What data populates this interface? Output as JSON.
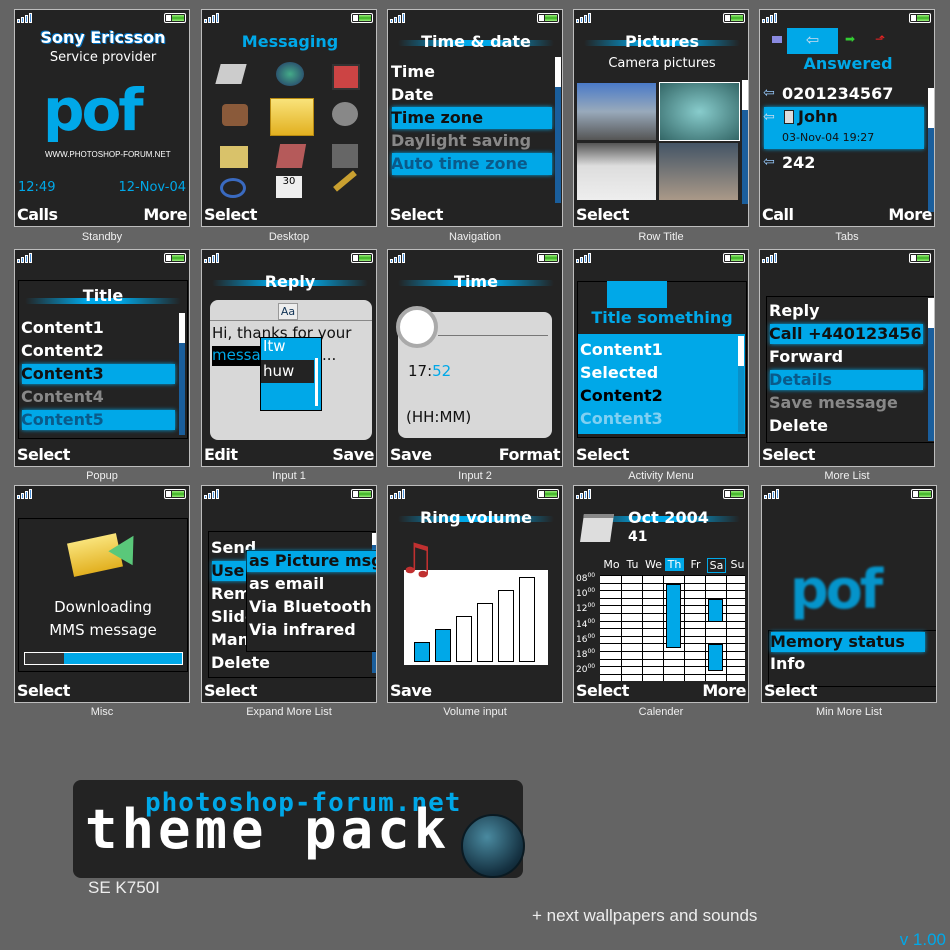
{
  "screens": {
    "standby": {
      "caption": "Standby",
      "operator": "Sony Ericsson",
      "provider": "Service provider",
      "logo": "pof",
      "logo_url": "WWW.PHOTOSHOP-FORUM.NET",
      "time": "12:49",
      "date": "12-Nov-04",
      "soft_left": "Calls",
      "soft_right": "More"
    },
    "desktop": {
      "caption": "Desktop",
      "title": "Messaging",
      "icons": [
        "call-list-icon",
        "internet-icon",
        "entertainment-icon",
        "camera-icon",
        "messaging-icon",
        "media-player-icon",
        "file-manager-icon",
        "phonebook-icon",
        "radio-icon",
        "connectivity-icon",
        "organizer-icon",
        "settings-icon"
      ],
      "soft_left": "Select"
    },
    "navigation": {
      "caption": "Navigation",
      "title": "Time & date",
      "items": [
        "Time",
        "Date",
        "Time zone",
        "Daylight saving",
        "Auto time zone"
      ],
      "soft_left": "Select"
    },
    "row_title": {
      "caption": "Row Title",
      "title": "Pictures",
      "subtitle": "Camera pictures",
      "soft_left": "Select"
    },
    "tabs": {
      "caption": "Tabs",
      "tab_label": "Answered",
      "entries": [
        {
          "name": "0201234567",
          "detail": ""
        },
        {
          "name": "John",
          "detail": "03-Nov-04 19:27"
        },
        {
          "name": "242",
          "detail": ""
        }
      ],
      "soft_left": "Call",
      "soft_right": "More"
    },
    "popup": {
      "caption": "Popup",
      "title": "Title",
      "items": [
        "Content1",
        "Content2",
        "Content3",
        "Content4",
        "Content5"
      ],
      "soft_left": "Select"
    },
    "input1": {
      "caption": "Input 1",
      "title": "Reply",
      "mode": "Aa",
      "text_line1": "Hi, thanks for your",
      "text_word": "messag",
      "text_rest": "...",
      "suggestions": [
        "Itw",
        "huw"
      ],
      "soft_left": "Edit",
      "soft_right": "Save"
    },
    "input2": {
      "caption": "Input 2",
      "title": "Time",
      "hours": "17:",
      "minutes": "52",
      "format": "(HH:MM)",
      "soft_left": "Save",
      "soft_right": "Format"
    },
    "activity": {
      "caption": "Activity Menu",
      "title": "Title something",
      "items": [
        "Content1",
        "Selected",
        "Content2",
        "Content3"
      ],
      "soft_left": "Select"
    },
    "more_list": {
      "caption": "More List",
      "items": [
        "Reply",
        "Call +440123456",
        "Forward",
        "Details",
        "Save message",
        "Delete"
      ],
      "soft_left": "Select"
    },
    "misc": {
      "caption": "Misc",
      "line1": "Downloading",
      "line2": "MMS message",
      "progress": 0.75,
      "soft_left": "Select"
    },
    "expand": {
      "caption": "Expand More List",
      "items": [
        "Send",
        "Use",
        "Rem",
        "Slide",
        "Many",
        "Delete"
      ],
      "submenu": [
        "as Picture msg",
        "as email",
        "Via Bluetooth",
        "Via infrared"
      ],
      "soft_left": "Select"
    },
    "volume": {
      "caption": "Volume input",
      "title": "Ring volume",
      "level": 2,
      "max": 7,
      "soft_left": "Save"
    },
    "calendar": {
      "caption": "Calender",
      "month": "Oct 2004",
      "week": "41",
      "days": [
        "Mo",
        "Tu",
        "We",
        "Th",
        "Fr",
        "Sa",
        "Su"
      ],
      "today": "Th",
      "selected": "Sa",
      "hours": [
        "08",
        "10",
        "12",
        "14",
        "16",
        "18",
        "20"
      ],
      "soft_left": "Select",
      "soft_right": "More"
    },
    "min_more": {
      "caption": "Min More List",
      "items": [
        "Memory status",
        "Info"
      ],
      "soft_left": "Select"
    }
  },
  "banner": {
    "site": "photoshop-forum.net",
    "title": "theme pack",
    "model": "SE K750I",
    "note": "+ next wallpapers and sounds",
    "version": "v 1.00"
  },
  "colors": {
    "accent": "#00a8e8",
    "background": "#646464",
    "screen": "#232323"
  }
}
